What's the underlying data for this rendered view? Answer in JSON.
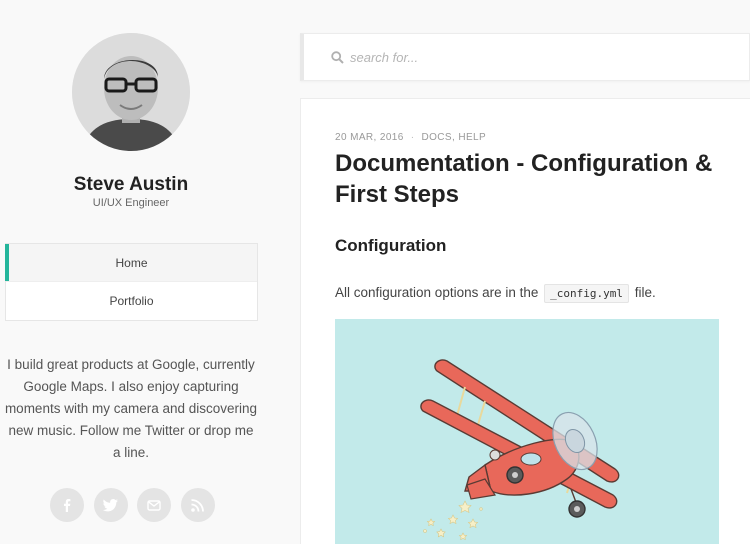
{
  "author": {
    "name": "Steve Austin",
    "role": "UI/UX Engineer"
  },
  "nav": {
    "items": [
      {
        "label": "Home",
        "active": true
      },
      {
        "label": "Portfolio",
        "active": false
      }
    ]
  },
  "bio": "I build great products at Google, currently Google Maps. I also enjoy capturing moments with my camera and discovering new music. Follow me Twitter or drop me a line.",
  "social": {
    "icons": [
      "facebook-icon",
      "twitter-icon",
      "email-icon",
      "rss-icon"
    ]
  },
  "search": {
    "placeholder": "search for..."
  },
  "post": {
    "date": "20 Mar, 2016",
    "separator": "·",
    "categories": [
      "Docs",
      "Help"
    ],
    "category_sep": ",",
    "title": "Documentation - Configuration & First Steps",
    "section_heading": "Configuration",
    "paragraph_before": "All configuration options are in the",
    "code": "_config.yml",
    "paragraph_after": "file."
  },
  "colors": {
    "accent": "#24b59b",
    "hero_bg": "#c2eaea",
    "plane": "#e8685a"
  }
}
